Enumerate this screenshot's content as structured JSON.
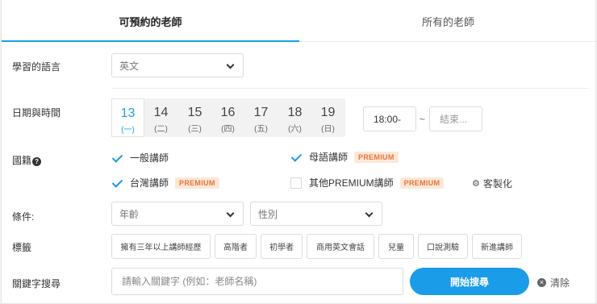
{
  "tabs": [
    {
      "label": "可預約的老師",
      "active": true
    },
    {
      "label": "所有的老師",
      "active": false
    }
  ],
  "language": {
    "label": "學習的語言",
    "value": "英文"
  },
  "datetime": {
    "label": "日期與時間",
    "dates": [
      {
        "num": "13",
        "weekday": "(一)",
        "active": true
      },
      {
        "num": "14",
        "weekday": "(二)",
        "active": false
      },
      {
        "num": "15",
        "weekday": "(三)",
        "active": false
      },
      {
        "num": "16",
        "weekday": "(四)",
        "active": false
      },
      {
        "num": "17",
        "weekday": "(五)",
        "active": false
      },
      {
        "num": "18",
        "weekday": "(六)",
        "active": false
      },
      {
        "num": "19",
        "weekday": "(日)",
        "active": false
      }
    ],
    "start_time": "18:00-",
    "separator": "~",
    "end_placeholder": "結束..."
  },
  "nationality": {
    "label": "國籍",
    "help_icon": "?",
    "options": [
      {
        "label": "一般講師",
        "checked": true,
        "premium": false
      },
      {
        "label": "母語講師",
        "checked": true,
        "premium": true
      },
      {
        "label": "台灣講師",
        "checked": true,
        "premium": true
      },
      {
        "label": "其他PREMIUM講師",
        "checked": false,
        "premium": true
      }
    ],
    "premium_badge": "PREMIUM",
    "customize_label": "客製化",
    "customize_icon": "gear-icon"
  },
  "conditions": {
    "label": "條件:",
    "age_placeholder": "年齡",
    "gender_placeholder": "性別"
  },
  "tags": {
    "label": "標籤",
    "items": [
      "擁有三年以上講師經歷",
      "高階者",
      "初學者",
      "商用英文會話",
      "兒童",
      "口說測驗",
      "新進講師"
    ]
  },
  "keyword": {
    "label": "關鍵字搜尋",
    "placeholder": "請輸入關鍵字 (例如：老師名稱)",
    "search_button": "開始搜尋",
    "clear_label": "清除"
  },
  "colors": {
    "accent": "#1a9ce8",
    "premium_bg": "#fde8d8",
    "premium_text": "#e8743b"
  }
}
